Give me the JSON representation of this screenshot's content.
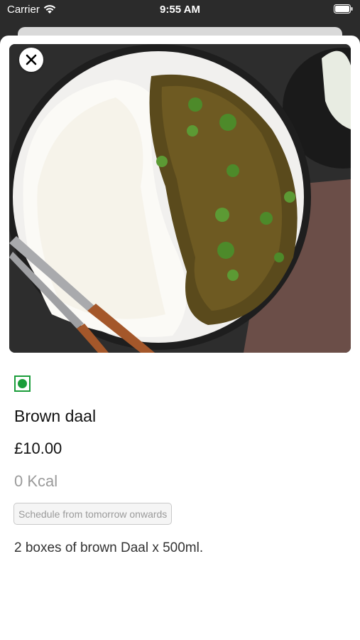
{
  "status_bar": {
    "carrier": "Carrier",
    "time": "9:55 AM"
  },
  "dish": {
    "image_alt": "Plate of brown daal with rice",
    "veg_indicator_color": "#1a9d3a",
    "name": "Brown daal",
    "price": "£10.00",
    "calories": "0 Kcal",
    "schedule_label": "Schedule from tomorrow onwards",
    "description": "2 boxes of brown Daal x 500ml."
  },
  "icons": {
    "close": "close-icon",
    "wifi": "wifi-icon",
    "battery": "battery-icon",
    "veg": "veg-indicator-icon"
  }
}
